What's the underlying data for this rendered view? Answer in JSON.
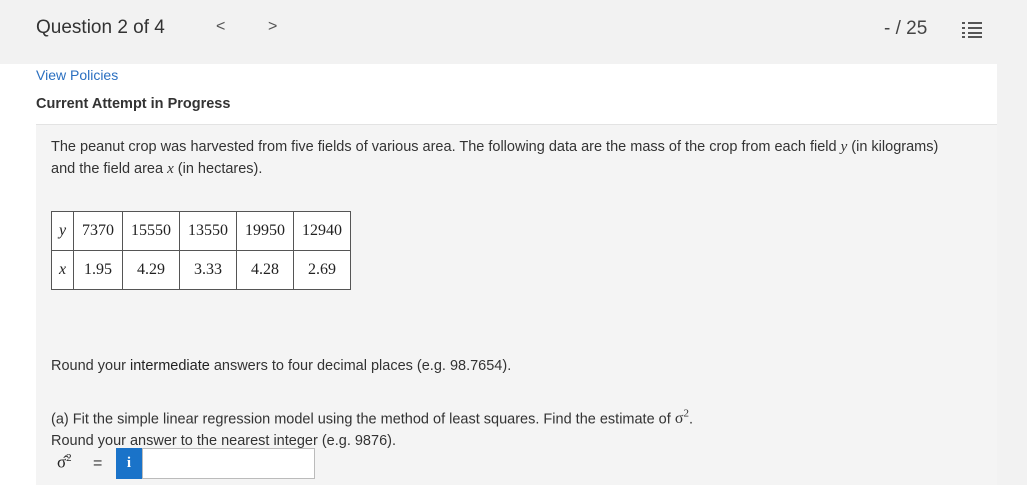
{
  "header": {
    "question_label": "Question 2 of 4",
    "prev_icon": "<",
    "next_icon": ">",
    "score": "- / 25",
    "list_icon": "question-list-icon"
  },
  "links": {
    "view_policies": "View Policies"
  },
  "status": {
    "attempt": "Current Attempt in Progress"
  },
  "problem": {
    "text_1": "The peanut crop was harvested from five fields of various area. The following data are the mass of the crop from each field ",
    "var_y": "y",
    "text_2": " (in kilograms) and the field area ",
    "var_x": "x",
    "text_3": " (in hectares)."
  },
  "table": {
    "y_label": "y",
    "x_label": "x",
    "y_values": [
      "7370",
      "15550",
      "13550",
      "19950",
      "12940"
    ],
    "x_values": [
      "1.95",
      "4.29",
      "3.33",
      "4.28",
      "2.69"
    ]
  },
  "instructions": {
    "round_prefix": "Round your ",
    "round_highlight": "intermediate",
    "round_suffix": " answers to four decimal places (e.g. 98.7654)."
  },
  "part_a": {
    "text": "(a) Fit the simple linear regression model using the method of least squares. Find the estimate of ",
    "sigma": "σ",
    "sigma_exp": "2",
    "period": ".",
    "round_text": "Round your answer to the nearest integer (e.g. 9876).",
    "answer_symbol": "σ̂",
    "answer_exp": "2",
    "equals": "=",
    "info_label": "i",
    "answer_value": ""
  },
  "colors": {
    "link": "#2a6fc0",
    "info_button": "#1a73c9"
  }
}
